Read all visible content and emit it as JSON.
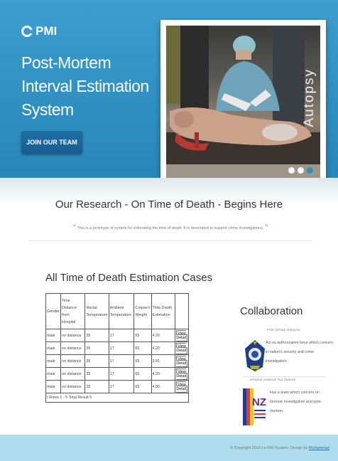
{
  "hero": {
    "logo_text": "PMI",
    "title": "Post-Mortem Interval Estimation System",
    "join_button": "JOIN OUR TEAM",
    "slide_label": "Autopsy",
    "slider_dots": 3,
    "slider_active_dot": 3
  },
  "research": {
    "title": "Our Research - On Time of Death - Begins Here",
    "quote_open": "“",
    "quote_text": "This is a prototype of system for estimating the time of death. It is developed to support crime investigations.",
    "quote_close": "”"
  },
  "cases": {
    "title": "All Time of Death Estimation Cases",
    "columns": [
      "Gender",
      "Time Distance from Hospital",
      "Rectal Temperature",
      "Ambient Temperature",
      "Corpse's Weight",
      "Time Death Estimation",
      ""
    ],
    "rows": [
      [
        "male",
        "no distance",
        "35",
        "17",
        "65",
        "4.20",
        "View Detail"
      ],
      [
        "male",
        "no distance",
        "35",
        "17",
        "65",
        "4.20",
        "View Detail"
      ],
      [
        "male",
        "no distance",
        "35",
        "17",
        "65",
        "3.81",
        "View Detail"
      ],
      [
        "male",
        "no distance",
        "35",
        "17",
        "65",
        "4.20",
        "View Detail"
      ],
      [
        "male",
        "no distance",
        "35",
        "17",
        "65",
        "4.80",
        "View Detail"
      ]
    ],
    "footer": "Rows 1 - 5 Total Result 5"
  },
  "collaboration": {
    "title": "Collaboration",
    "items": [
      {
        "name": "Polis DiRaja Malaysia",
        "description": "Act as authorization force which concern in nation's security and crime investigation."
      },
      {
        "name": "Hospital Sultanah Nur Zahirah",
        "description": "Has a team which concern on forensic investigation and post-mortem."
      }
    ]
  },
  "footer": {
    "copyright": "© Copyright 2016 | e-PMI System. Design by",
    "designer": "Muhammad"
  },
  "colors": {
    "hero_blue": "#3c9fd0",
    "button_blue": "#1f6fa8",
    "footer_bg": "#addcec"
  }
}
